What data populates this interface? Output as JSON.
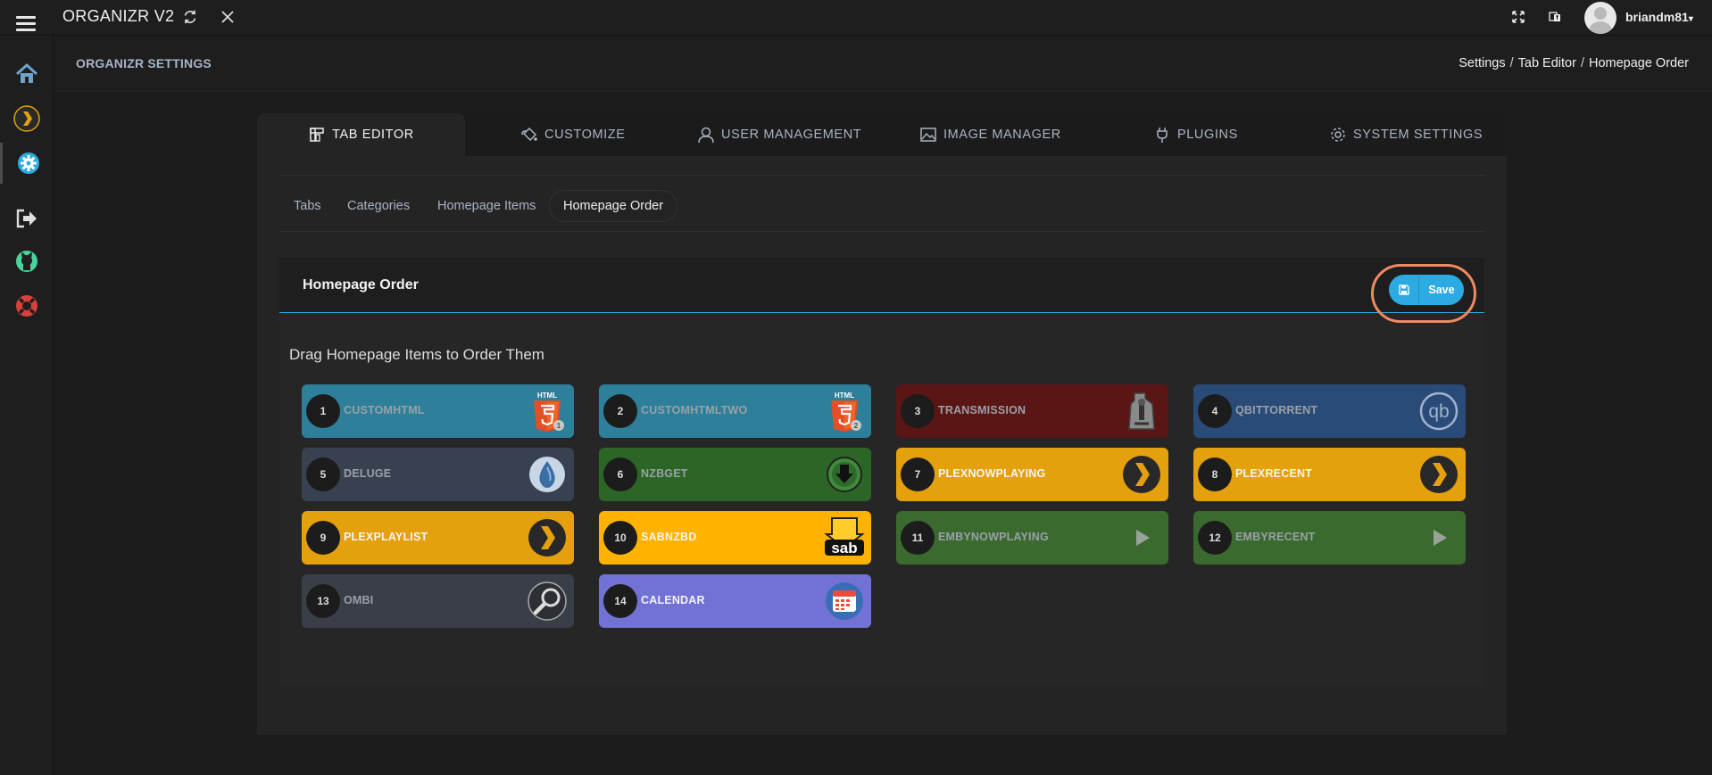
{
  "app": {
    "title": "ORGANIZR V2",
    "user": "briandm81"
  },
  "header": {
    "title": "ORGANIZR SETTINGS",
    "breadcrumb": [
      "Settings",
      "Tab Editor",
      "Homepage Order"
    ]
  },
  "main_tabs": [
    {
      "label": "TAB EDITOR",
      "icon": "tab-editor-icon",
      "active": true
    },
    {
      "label": "CUSTOMIZE",
      "icon": "paint-bucket-icon"
    },
    {
      "label": "USER MANAGEMENT",
      "icon": "user-icon"
    },
    {
      "label": "IMAGE MANAGER",
      "icon": "image-icon"
    },
    {
      "label": "PLUGINS",
      "icon": "plug-icon"
    },
    {
      "label": "SYSTEM SETTINGS",
      "icon": "gear-icon"
    }
  ],
  "sub_tabs": [
    "Tabs",
    "Categories",
    "Homepage Items",
    "Homepage Order"
  ],
  "card": {
    "title": "Homepage Order",
    "save_label": "Save"
  },
  "drag_title": "Drag Homepage Items to Order Them",
  "items": [
    {
      "n": "1",
      "name": "CUSTOMHTML",
      "color": "#2d7f9a",
      "logo": "html5-icon"
    },
    {
      "n": "2",
      "name": "CUSTOMHTMLTWO",
      "color": "#2d7f9a",
      "logo": "html5-icon"
    },
    {
      "n": "3",
      "name": "TRANSMISSION",
      "color": "#5a1515",
      "logo": "transmission-icon"
    },
    {
      "n": "4",
      "name": "QBITTORRENT",
      "color": "#2a4a78",
      "logo": "qbittorrent-icon"
    },
    {
      "n": "5",
      "name": "DELUGE",
      "color": "#37414f",
      "logo": "deluge-icon"
    },
    {
      "n": "6",
      "name": "NZBGET",
      "color": "#2c6626",
      "logo": "nzbget-icon"
    },
    {
      "n": "7",
      "name": "PLEXNOWPLAYING",
      "color": "#e5a00d",
      "logo": "plex-icon"
    },
    {
      "n": "8",
      "name": "PLEXRECENT",
      "color": "#e5a00d",
      "logo": "plex-icon"
    },
    {
      "n": "9",
      "name": "PLEXPLAYLIST",
      "color": "#e5a00d",
      "logo": "plex-icon"
    },
    {
      "n": "10",
      "name": "SABNZBD",
      "color": "#ffb300",
      "logo": "sabnzbd-icon"
    },
    {
      "n": "11",
      "name": "EMBYNOWPLAYING",
      "color": "#3a6a2e",
      "logo": "emby-play-icon"
    },
    {
      "n": "12",
      "name": "EMBYRECENT",
      "color": "#3a6a2e",
      "logo": "emby-play-icon"
    },
    {
      "n": "13",
      "name": "OMBI",
      "color": "#3a3f47",
      "logo": "ombi-icon"
    },
    {
      "n": "14",
      "name": "CALENDAR",
      "color": "#7272d4",
      "logo": "calendar-icon"
    }
  ],
  "sidebar": [
    "home-icon",
    "plex-icon",
    "settings-gear-icon",
    "logout-icon",
    "github-icon",
    "help-lifebuoy-icon"
  ]
}
